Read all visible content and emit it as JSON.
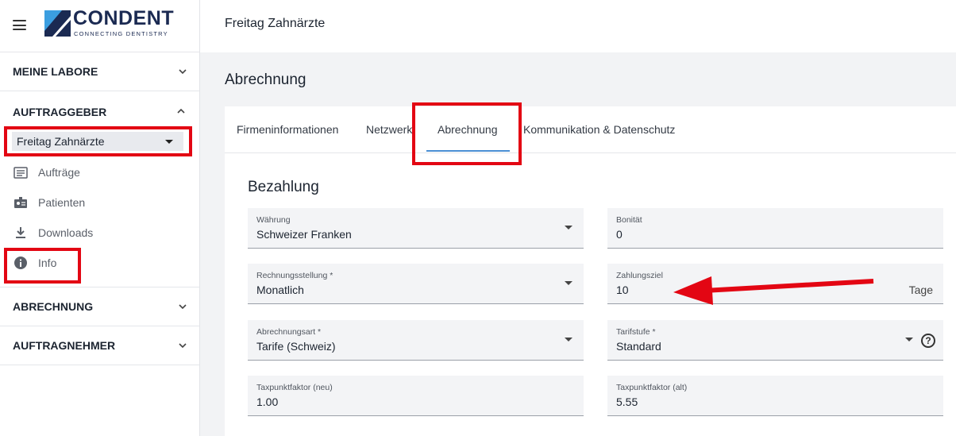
{
  "brand": {
    "name": "CONDENT",
    "tagline": "CONNECTING DENTISTRY"
  },
  "sidebar": {
    "meine_labore": "MEINE LABORE",
    "auftraggeber": "AUFTRAGGEBER",
    "selected_client": "Freitag Zahnärzte",
    "items": [
      {
        "label": "Aufträge",
        "icon": "orders-icon"
      },
      {
        "label": "Patienten",
        "icon": "patients-icon"
      },
      {
        "label": "Downloads",
        "icon": "download-icon"
      },
      {
        "label": "Info",
        "icon": "info-icon"
      }
    ],
    "abrechnung": "ABRECHNUNG",
    "auftragnehmer": "AUFTRAGNEHMER"
  },
  "header": {
    "title": "Freitag Zahnärzte"
  },
  "page": {
    "title": "Abrechnung"
  },
  "tabs": [
    {
      "label": "Firmeninformationen"
    },
    {
      "label": "Netzwerk"
    },
    {
      "label": "Abrechnung",
      "active": true
    },
    {
      "label": "Kommunikation & Datenschutz"
    }
  ],
  "form": {
    "section_title": "Bezahlung",
    "waehrung": {
      "label": "Währung",
      "value": "Schweizer Franken"
    },
    "bonitaet": {
      "label": "Bonität",
      "value": "0"
    },
    "rechnungsstellung": {
      "label": "Rechnungsstellung *",
      "value": "Monatlich"
    },
    "zahlungsziel": {
      "label": "Zahlungsziel",
      "value": "10",
      "suffix": "Tage"
    },
    "abrechnungsart": {
      "label": "Abrechnungsart *",
      "value": "Tarife (Schweiz)"
    },
    "tarifstufe": {
      "label": "Tarifstufe *",
      "value": "Standard",
      "help": "?"
    },
    "taxpunkt_neu": {
      "label": "Taxpunktfaktor (neu)",
      "value": "1.00"
    },
    "taxpunkt_alt": {
      "label": "Taxpunktfaktor (alt)",
      "value": "5.55"
    }
  },
  "colors": {
    "highlight": "#e30613",
    "tab_active": "#4a8fd4",
    "brand": "#1b2a52",
    "logo_blue": "#3b9ee0"
  }
}
